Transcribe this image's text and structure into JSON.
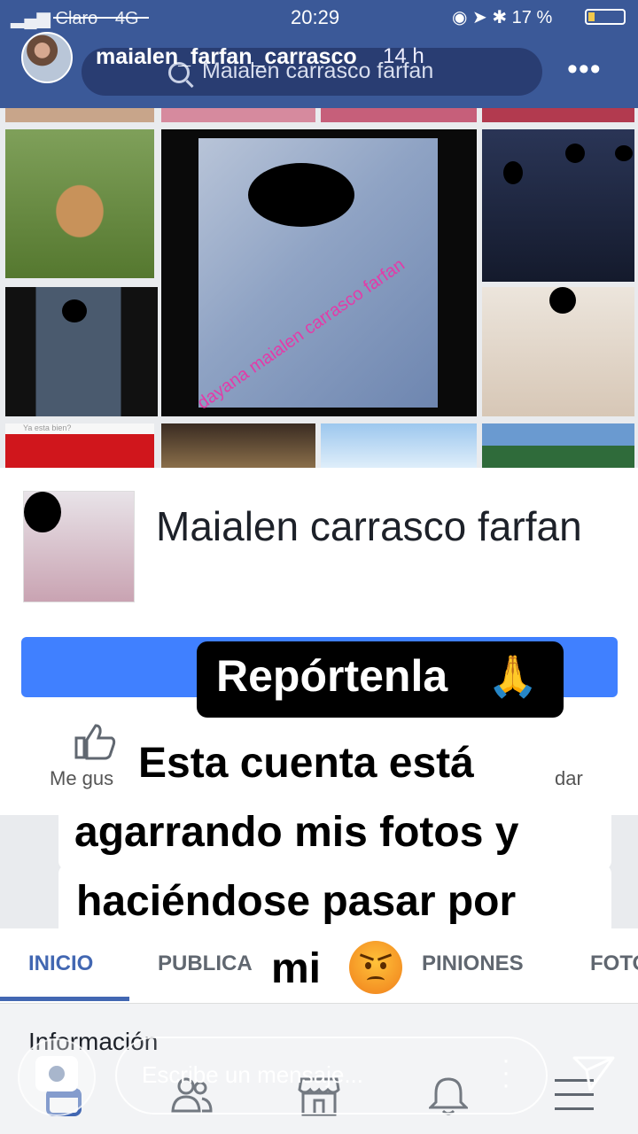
{
  "status_bar": {
    "carrier": "Claro",
    "network": "4G",
    "time": "20:29",
    "battery_text": "17 %"
  },
  "story": {
    "username": "maialen_farfan_carrasco",
    "time_ago": "14 h"
  },
  "facebook": {
    "search_text": "Maialen carrasco farfan",
    "collage_watermark": "dayana maialen carrasco farfan",
    "collage_caption": "Ya esta bien?",
    "page_name": "Maialen carrasco farfan",
    "like_label": "Me gus",
    "share_label": "dar",
    "tabs": [
      {
        "label": "INICIO"
      },
      {
        "label": "PUBLICA"
      },
      {
        "label": "PINIONES"
      },
      {
        "label": "FOTO"
      }
    ],
    "info_title": "Información"
  },
  "stickers": {
    "top": "Repórtenla",
    "lines": [
      "Esta cuenta está",
      "agarrando mis fotos y",
      "haciéndose pasar por",
      "mi"
    ]
  },
  "reply_bar": {
    "placeholder": "Escribe un mensaje..."
  },
  "colors": {
    "fb_blue": "#3b5998",
    "button_blue": "#4080ff",
    "tab_blue": "#4267b2"
  }
}
